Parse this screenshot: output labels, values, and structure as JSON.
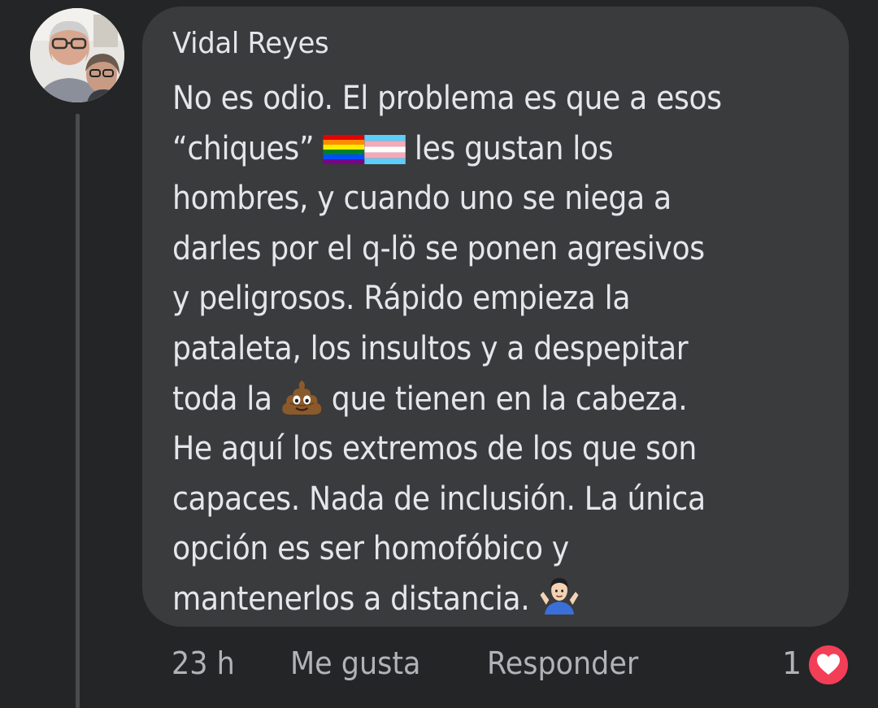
{
  "comment": {
    "author": "Vidal Reyes",
    "lines": [
      "No es odio. El problema es que a esos",
      "“chiques”",
      "les gustan los",
      "hombres, y cuando uno se niega a",
      "darles por el q-lö se ponen agresivos",
      "y peligrosos. Rápido empieza la",
      "pataleta, los insultos y a despepitar",
      "toda la",
      "que tienen en la cabeza.",
      "He aquí los extremos de los que son",
      "capaces. Nada de inclusión. La única",
      "opción es ser homofóbico y",
      "mantenerlos a distancia."
    ],
    "emojis": {
      "line2_after_chiques": [
        "rainbow-flag-icon",
        "transgender-flag-icon"
      ],
      "line8_after_toda_la": "pile-of-poo-icon",
      "line13_end": "person-shrugging-icon"
    }
  },
  "footer": {
    "time": "23 h",
    "like_label": "Me gusta",
    "reply_label": "Responder",
    "reaction_count": "1",
    "reaction_icon": "heart-icon"
  },
  "colors": {
    "background": "#242526",
    "bubble": "#3a3b3c",
    "primary_text": "#e4e6eb",
    "secondary_text": "#b0b3b8",
    "heart_red": "#f33e58"
  }
}
